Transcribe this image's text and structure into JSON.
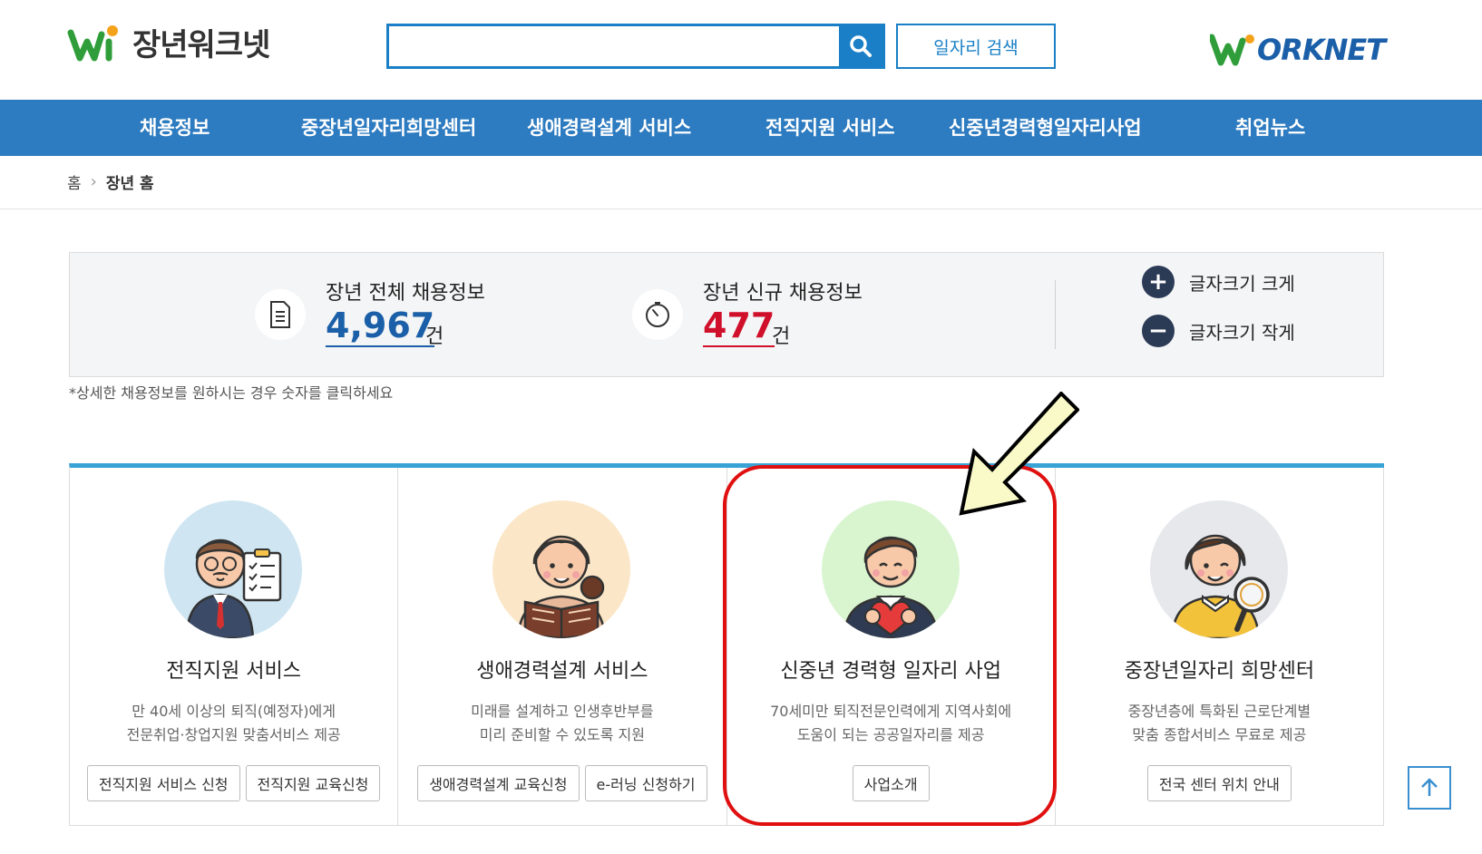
{
  "header": {
    "logo_text": "장년워크넷",
    "search_placeholder": "",
    "job_search_label": "일자리 검색",
    "worknet_logo_text": "ORKNET"
  },
  "nav": {
    "items": [
      {
        "label": "채용정보"
      },
      {
        "label": "중장년일자리희망센터"
      },
      {
        "label": "생애경력설계 서비스"
      },
      {
        "label": "전직지원 서비스"
      },
      {
        "label": "신중년경력형일자리사업"
      },
      {
        "label": "취업뉴스"
      }
    ]
  },
  "breadcrumb": {
    "home": "홈",
    "current": "장년 홈"
  },
  "stats": {
    "total": {
      "label": "장년 전체 채용정보",
      "value": "4,967",
      "unit": "건",
      "color": "#1a5fa8"
    },
    "new": {
      "label": "장년 신규 채용정보",
      "value": "477",
      "unit": "건",
      "color": "#d0102a"
    },
    "font_larger": "글자크기 크게",
    "font_smaller": "글자크기 작게",
    "note": "*상세한 채용정보를 원하시는 경우 숫자를 클릭하세요"
  },
  "cards": [
    {
      "title": "전직지원 서비스",
      "desc": [
        "만 40세 이상의 퇴직(예정자)에게",
        "전문취업·창업지원 맞춤서비스 제공"
      ],
      "buttons": [
        "전직지원 서비스 신청",
        "전직지원 교육신청"
      ],
      "avatar_bg": "#cfe6f2"
    },
    {
      "title": "생애경력설계 서비스",
      "desc": [
        "미래를 설계하고 인생후반부를",
        "미리 준비할 수 있도록 지원"
      ],
      "buttons": [
        "생애경력설계 교육신청",
        "e-러닝 신청하기"
      ],
      "avatar_bg": "#fbe7c8"
    },
    {
      "title": "신중년 경력형 일자리 사업",
      "desc": [
        "70세미만 퇴직전문인력에게 지역사회에",
        "도움이 되는 공공일자리를 제공"
      ],
      "buttons": [
        "사업소개"
      ],
      "avatar_bg": "#d9f5d0"
    },
    {
      "title": "중장년일자리 희망센터",
      "desc": [
        "중장년층에 특화된 근로단계별",
        "맞춤 종합서비스 무료로 제공"
      ],
      "buttons": [
        "전국 센터 위치 안내"
      ],
      "avatar_bg": "#e6e8ec"
    }
  ],
  "colors": {
    "accent_blue": "#2d7bc0",
    "highlight_red": "#e01010",
    "arrow_fill": "#fafac8"
  }
}
